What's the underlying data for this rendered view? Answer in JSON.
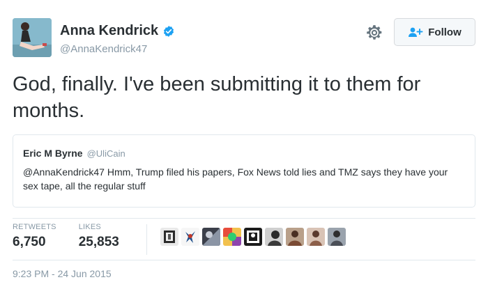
{
  "author": {
    "display_name": "Anna Kendrick",
    "handle": "@AnnaKendrick47",
    "verified_icon": "verified-badge-icon",
    "avatar_icon": "avatar"
  },
  "actions": {
    "settings_icon": "gear-icon",
    "follow_label": "Follow",
    "follow_icon": "add-user-icon"
  },
  "tweet": {
    "text": "God, finally. I've been submitting it to them for months."
  },
  "quoted_tweet": {
    "name": "Eric M Byrne",
    "handle": "@UliCain",
    "text": "@AnnaKendrick47 Hmm, Trump filed his papers, Fox News told lies and TMZ says they have your sex tape, all the regular stuff"
  },
  "stats": {
    "retweets_label": "RETWEETS",
    "retweets_value": "6,750",
    "likes_label": "LIKES",
    "likes_value": "25,853"
  },
  "likers_count_shown": 9,
  "timestamp": "9:23 PM - 24 Jun 2015",
  "colors": {
    "text": "#292f33",
    "muted": "#8899a6",
    "verified_blue": "#1da1f2",
    "border": "#e1e8ed"
  }
}
